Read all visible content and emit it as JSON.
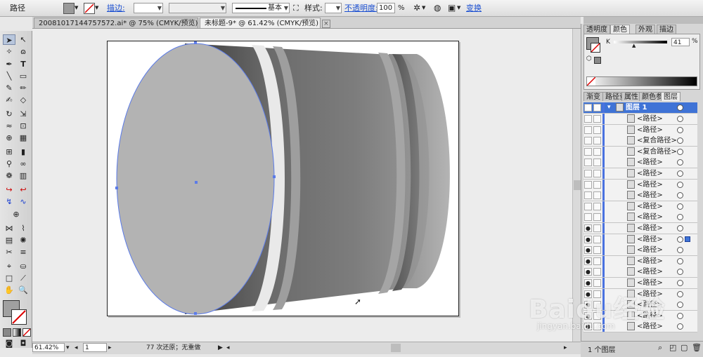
{
  "control_bar": {
    "object_type": "路径",
    "stroke_label": "描边:",
    "stroke_profile": "基本",
    "style_label": "样式:",
    "opacity_label": "不透明度:",
    "opacity_value": "100",
    "opacity_unit": "%",
    "transform_label": "变换"
  },
  "document_tabs": [
    {
      "label": "20081017144757572.ai* @ 75% (CMYK/预览)"
    },
    {
      "label": "未标题-9* @ 61.42% (CMYK/预览)"
    }
  ],
  "color_panel": {
    "tabs": [
      "透明度",
      "颜色",
      "外观",
      "描边"
    ],
    "channel_label": "K",
    "channel_value": "41",
    "channel_unit": "%"
  },
  "layers_panel": {
    "tabs": [
      "渐变",
      "路径查",
      "属性",
      "颜色参",
      "图层"
    ],
    "layer_name": "图层 1",
    "items": [
      {
        "label": "<路径>"
      },
      {
        "label": "<路径>"
      },
      {
        "label": "<复合路径>"
      },
      {
        "label": "<复合路径>"
      },
      {
        "label": "<路径>"
      },
      {
        "label": "<路径>"
      },
      {
        "label": "<路径>"
      },
      {
        "label": "<路径>"
      },
      {
        "label": "<路径>"
      },
      {
        "label": "<路径>"
      },
      {
        "label": "<路径>"
      },
      {
        "label": "<路径>"
      },
      {
        "label": "<路径>"
      },
      {
        "label": "<路径>"
      },
      {
        "label": "<路径>"
      },
      {
        "label": "<路径>"
      },
      {
        "label": "<路径>"
      },
      {
        "label": "<路径>"
      },
      {
        "label": "<路径>"
      },
      {
        "label": "<路径>"
      }
    ],
    "footer_count": "1 个图层"
  },
  "status_bar": {
    "zoom": "61.42%",
    "page": "1",
    "undo_info": "77 次还原；无重做"
  },
  "watermark": {
    "text": "Baidu经验",
    "sub": "jingyan.baidu.com"
  },
  "colors": {
    "accent": "#3f73d6",
    "selection": "#5b7be8"
  }
}
